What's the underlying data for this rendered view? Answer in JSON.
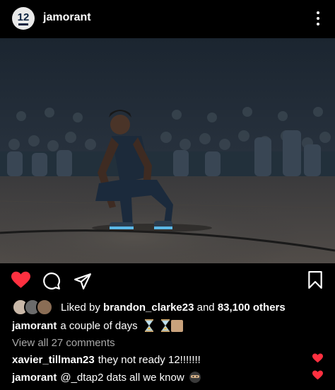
{
  "post": {
    "username": "jamorant",
    "avatar_number": "12"
  },
  "likes": {
    "prefix": "Liked by",
    "user": "brandon_clarke23",
    "middle": "and",
    "count": "83,100 others"
  },
  "caption": {
    "username": "jamorant",
    "text": "a couple of days"
  },
  "view_all": "View all 27 comments",
  "comments": [
    {
      "username": "xavier_tillman23",
      "text": "they not ready 12!!!!!!!"
    },
    {
      "username": "jamorant",
      "text": "@_dtap2 dats all we know"
    }
  ],
  "icons": {
    "more": "more-vertical-icon",
    "like": "heart-icon",
    "comment": "comment-icon",
    "share": "send-icon",
    "save": "bookmark-icon"
  },
  "colors": {
    "like_red": "#ff3040",
    "muted": "#a8a8a8"
  }
}
